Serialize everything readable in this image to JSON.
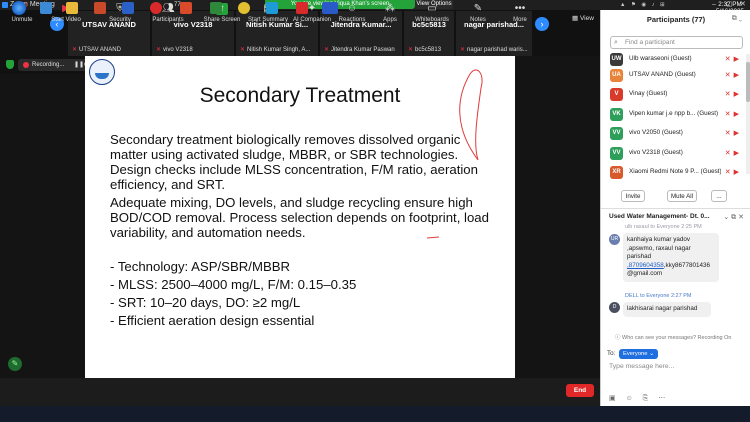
{
  "window": {
    "title": "Zoom Meeting",
    "viewing_banner": "You are viewing Viqua Khan's screen",
    "view_options": "View Options"
  },
  "strip": {
    "view_label": "View",
    "tiles": [
      {
        "name": "UTSAV ANAND",
        "sub": "UTSAV ANAND"
      },
      {
        "name": "vivo V2318",
        "sub": "vivo V2318"
      },
      {
        "name": "Nitish Kumar Si...",
        "sub": "Nitish Kumar Singh, A..."
      },
      {
        "name": "Jitendra Kumar...",
        "sub": "Jitendra Kumar Paswan"
      },
      {
        "name": "bc5c5813",
        "sub": "bc5c5813"
      },
      {
        "name": "nagar parishad...",
        "sub": "nagar parishad waris..."
      }
    ]
  },
  "recording": {
    "label": "Recording..."
  },
  "slide": {
    "title": "Secondary Treatment",
    "paragraphs": [
      "Secondary treatment biologically removes dissolved organic matter using activated sludge, MBBR, or SBR technologies. Design checks include MLSS concentration, F/M ratio, aeration efficiency, and SRT.",
      "Adequate mixing, DO levels, and sludge recycling ensure high BOD/COD removal. Process selection depends on footprint, load variability, and automation needs."
    ],
    "bullets": [
      "- Technology: ASP/SBR/MBBR",
      "- MLSS: 2500–4000 mg/L, F/M: 0.15–0.35",
      "- SRT: 10–20 days, DO: ≥2 mg/L",
      "- Efficient aeration design essential"
    ]
  },
  "toolbar": {
    "unmute": "Unmute",
    "start_video": "Start Video",
    "security": "Security",
    "participants": "Participants",
    "participants_count": "77",
    "share_screen": "Share Screen",
    "start_summary": "Start Summary",
    "ai_companion": "AI Companion",
    "reactions": "Reactions",
    "apps": "Apps",
    "whiteboards": "Whiteboards",
    "notes": "Notes",
    "more": "More",
    "end": "End"
  },
  "participants_panel": {
    "title": "Participants (77)",
    "search_placeholder": "Find a participant",
    "rows": [
      {
        "initials": "UW",
        "color": "#3a3a3a",
        "name": "Ulb waraseoni (Guest)"
      },
      {
        "initials": "UA",
        "color": "#e8833a",
        "name": "UTSAV ANAND (Guest)"
      },
      {
        "initials": "V",
        "color": "#d83b2b",
        "name": "Vinay (Guest)"
      },
      {
        "initials": "VK",
        "color": "#2e9e5b",
        "name": "Vipen kumar j.e  npp b... (Guest)"
      },
      {
        "initials": "VV",
        "color": "#2e9e5b",
        "name": "vivo V2050 (Guest)"
      },
      {
        "initials": "VV",
        "color": "#2e9e5b",
        "name": "vivo V2318 (Guest)"
      },
      {
        "initials": "XR",
        "color": "#d85a2b",
        "name": "Xiaomi Redmi Note 9 P... (Guest)"
      }
    ],
    "invite": "Invite",
    "mute_all": "Mute All",
    "more": "..."
  },
  "chat": {
    "title": "Used Water Management-  Dt. 0...",
    "truncated_from": "ulb raxaul to Everyone 2:25 PM",
    "message1_initials": "UR",
    "message1_text": "kanhaiya kumar yadov ,apswmo, raxaul nagar parishad",
    "message1_link": ",8709604358",
    "message1_tail": ",kky8677801436 @gmail.com",
    "message2_from": "DELL to Everyone 2:27 PM",
    "message2_initials": "D",
    "message2_text": "lakhisarai nagar parishad",
    "note": "Who can see your messages? Recording On",
    "to_label": "To:",
    "to_value": "Everyone",
    "input_placeholder": "Type message here..."
  },
  "taskbar": {
    "time": "2:32 PM",
    "date": "5/16/2025"
  }
}
